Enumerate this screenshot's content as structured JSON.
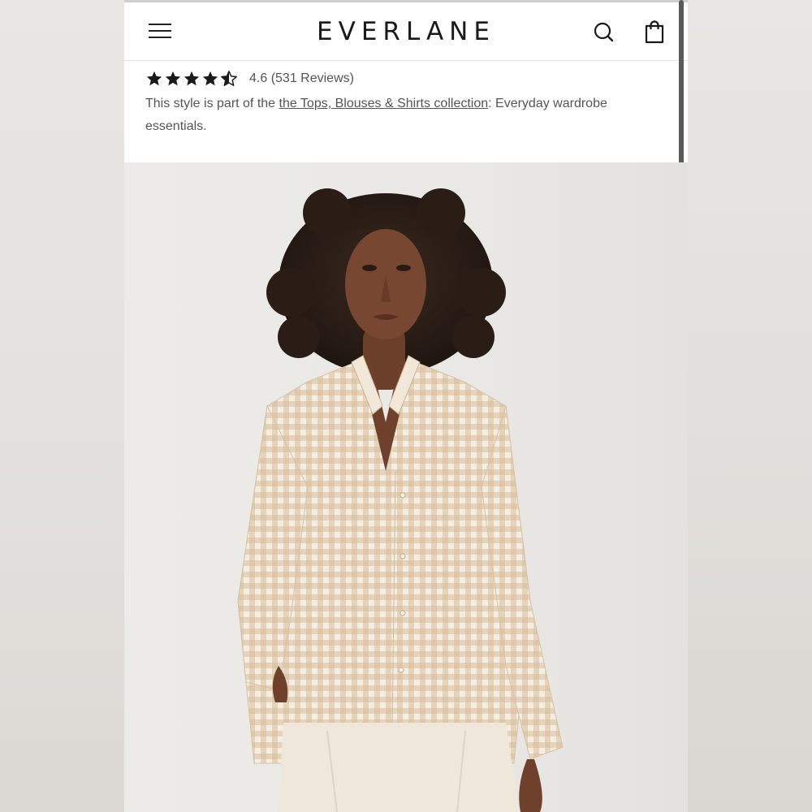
{
  "header": {
    "logo": "EVERLANE",
    "menu_icon": "hamburger-menu-icon",
    "search_icon": "search-icon",
    "bag_icon": "shopping-bag-icon"
  },
  "rating": {
    "value": 4.6,
    "text": "4.6 (531 Reviews)",
    "stars_full": 4,
    "stars_half": 1
  },
  "collection": {
    "prefix": "This style is part of the ",
    "link_text": "the Tops, Blouses & Shirts collection",
    "suffix": ": Everyday wardrobe essentials."
  },
  "hero_image": {
    "alt": "Model wearing a tan gingham linen shirt and cream pants"
  },
  "colors": {
    "background": "#ffffff",
    "text": "#555555",
    "logo": "#1a1a1a",
    "shirt_check": "#c9a57a",
    "shirt_base": "#f3ebe0"
  }
}
